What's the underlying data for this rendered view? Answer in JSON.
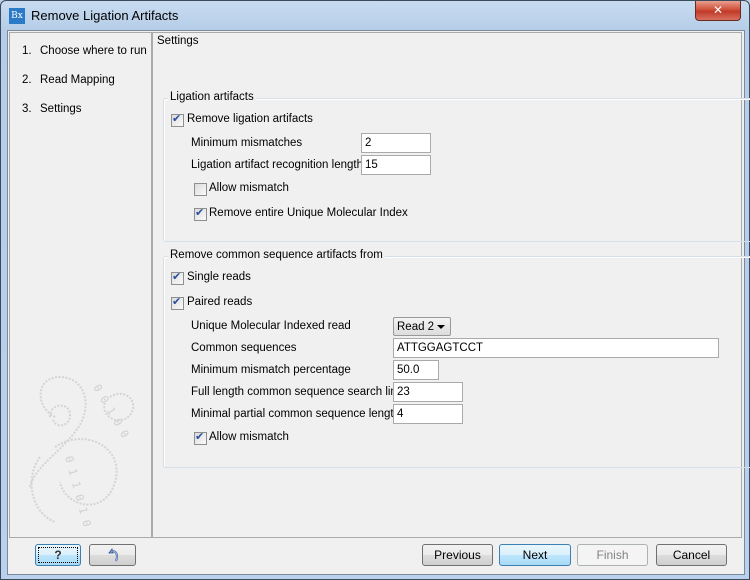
{
  "window": {
    "title": "Remove Ligation Artifacts",
    "app_icon_label": "Bx",
    "close_label": "✕"
  },
  "steps": [
    {
      "num": "1.",
      "label": "Choose where to run"
    },
    {
      "num": "2.",
      "label": "Read Mapping"
    },
    {
      "num": "3.",
      "label": "Settings"
    }
  ],
  "content": {
    "title": "Settings",
    "ligation_group": {
      "title": "Ligation artifacts",
      "remove_ligation": {
        "label": "Remove ligation artifacts",
        "checked": true
      },
      "min_mismatches": {
        "label": "Minimum mismatches",
        "value": "2"
      },
      "recognition_length": {
        "label": "Ligation artifact recognition length",
        "value": "15"
      },
      "allow_mismatch": {
        "label": "Allow mismatch",
        "checked": false
      },
      "remove_umi": {
        "label": "Remove entire Unique Molecular Index",
        "checked": true
      }
    },
    "common_group": {
      "title": "Remove common sequence artifacts from",
      "single_reads": {
        "label": "Single reads",
        "checked": true
      },
      "paired_reads": {
        "label": "Paired reads",
        "checked": true
      },
      "umi_read": {
        "label": "Unique Molecular Indexed read",
        "value": "Read 2"
      },
      "common_sequences": {
        "label": "Common sequences",
        "value": "ATTGGAGTCCT"
      },
      "min_mismatch_pct": {
        "label": "Minimum mismatch percentage",
        "value": "50.0"
      },
      "full_length_limit": {
        "label": "Full length common sequence search limit",
        "value": "23"
      },
      "minimal_partial_length": {
        "label": "Minimal partial common sequence length",
        "value": "4"
      },
      "allow_mismatch": {
        "label": "Allow mismatch",
        "checked": true
      }
    }
  },
  "footer": {
    "help_label": "?",
    "reset_icon": "undo-arrow-icon",
    "previous_label": "Previous",
    "next_label": "Next",
    "finish_label": "Finish",
    "cancel_label": "Cancel"
  }
}
